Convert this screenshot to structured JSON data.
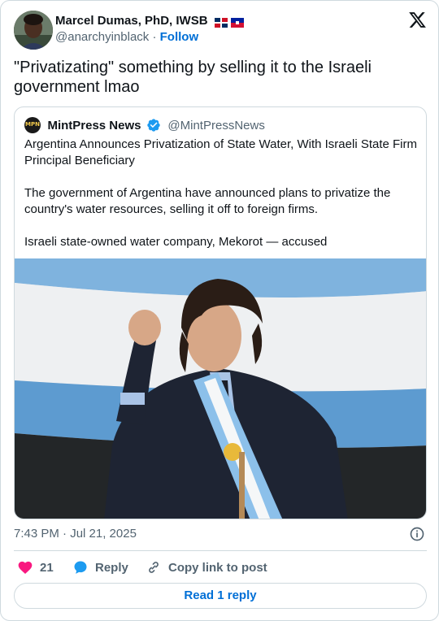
{
  "author": {
    "name": "Marcel Dumas, PhD, IWSB",
    "handle": "@anarchyinblack",
    "separator": "·",
    "follow_label": "Follow",
    "flag_icons": [
      "dominican-republic-flag-icon",
      "haiti-flag-icon"
    ]
  },
  "tweet": {
    "text": "\"Privatizating\" something by selling it to the Israeli government lmao",
    "timestamp": "7:43 PM · Jul 21, 2025"
  },
  "quote": {
    "name": "MintPress News",
    "handle": "@MintPressNews",
    "logo_text": "MPN",
    "paragraphs": [
      "Argentina Announces Privatization of State Water, With Israeli State Firm Principal Beneficiary",
      "",
      "The government of Argentina have announced plans to privatize the country's water resources, selling it off to foreign firms.",
      "",
      "Israeli  state-owned water company, Mekorot — accused"
    ]
  },
  "actions": {
    "like_count": "21",
    "reply_label": "Reply",
    "copy_label": "Copy link to post"
  },
  "read_replies_label": "Read 1 reply",
  "colors": {
    "link_blue": "#006fd6",
    "like_pink": "#f91880",
    "reply_blue": "#1d9bf0",
    "border": "#cfd9de",
    "secondary_text": "#536471"
  },
  "icons": [
    "x-logo-icon",
    "verified-badge-icon",
    "info-icon",
    "heart-icon",
    "reply-bubble-icon",
    "link-icon"
  ]
}
